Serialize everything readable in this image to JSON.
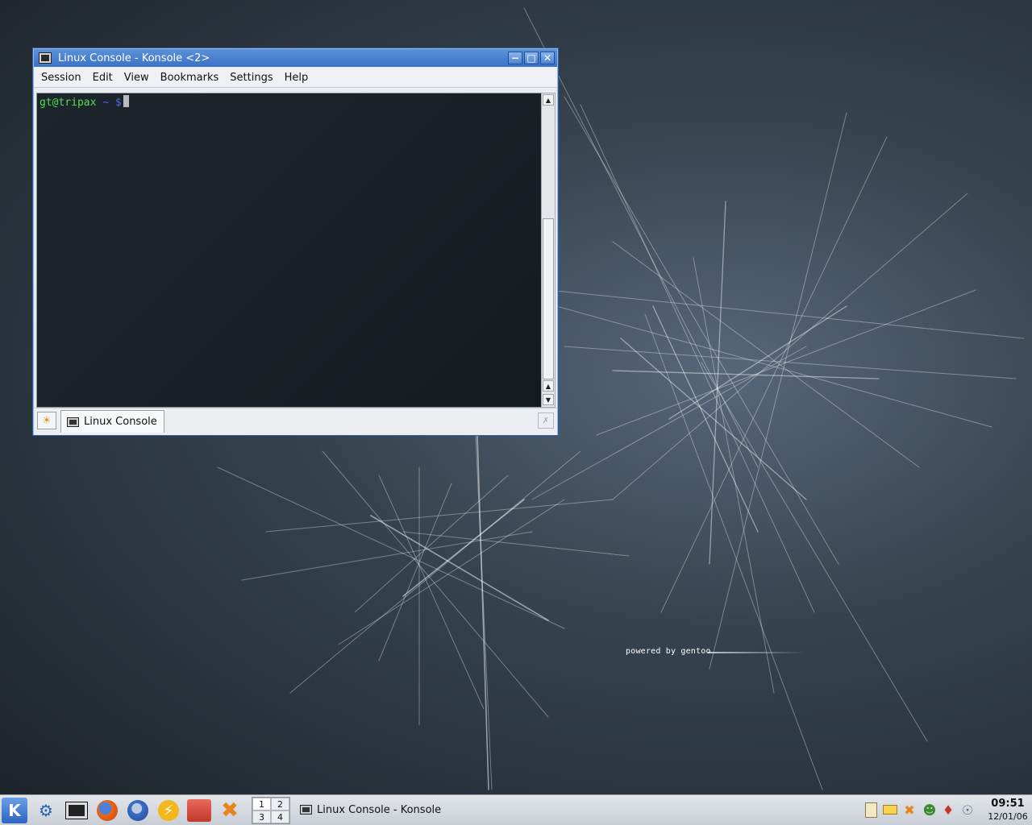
{
  "desktop": {
    "branding": "powered by gentoo"
  },
  "window": {
    "title": "Linux Console - Konsole <2>",
    "menu": [
      "Session",
      "Edit",
      "View",
      "Bookmarks",
      "Settings",
      "Help"
    ],
    "terminal": {
      "prompt_user": "gt@tripax",
      "prompt_path": "~ $"
    },
    "tabs": [
      {
        "label": "Linux Console"
      }
    ]
  },
  "taskbar": {
    "launchers": [
      "kde-menu-icon",
      "konqueror-icon",
      "konsole-icon",
      "firefox-icon",
      "thunderbird-icon",
      "lightning-icon",
      "audio-player-icon",
      "tools-icon"
    ],
    "pager": [
      "1",
      "2",
      "3",
      "4"
    ],
    "tasks": [
      {
        "label": "Linux Console - Konsole"
      }
    ],
    "tray": [
      "klipper-icon",
      "email-icon",
      "network-icon",
      "user-icon",
      "app-icon",
      "update-icon"
    ],
    "clock": {
      "time": "09:51",
      "date": "12/01/06"
    }
  },
  "colors": {
    "titlebar": "#3a72c6",
    "prompt_user": "#4ee04e",
    "prompt_path": "#5a64e8",
    "terminal_bg": "#1a2027"
  }
}
